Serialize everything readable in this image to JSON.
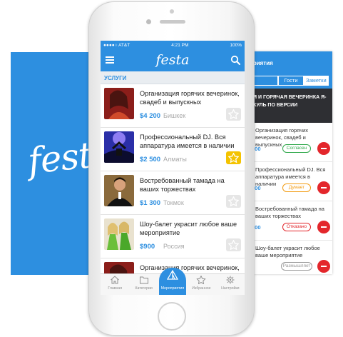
{
  "brand": {
    "logo": "festa",
    "accent": "#2d8fe0",
    "dark_banner": "#2e2f33",
    "star_active": "#f4c300"
  },
  "status_bar": {
    "carrier": "●●●●○ AT&T",
    "time": "4:21 PM",
    "battery": "100%"
  },
  "nav": {
    "menu_icon": "hamburger-icon",
    "search_icon": "search-icon"
  },
  "section_title": "УСЛУГИ",
  "items": [
    {
      "title": "Организация горячих вечеринок, свадеб и выпускных",
      "price": "$4 200",
      "city": "Бишкек",
      "favorite": false
    },
    {
      "title": "Профессиональный DJ. Вся аппаратура имеется в наличии",
      "price": "$2 500",
      "city": "Алматы",
      "favorite": true
    },
    {
      "title": "Востребованный тамада на ваших торжествах",
      "price": "$1 300",
      "city": "Токмок",
      "favorite": false
    },
    {
      "title": "Шоу-балет украсит любое ваше мероприятие",
      "price": "$900",
      "city": "Россия",
      "favorite": false
    },
    {
      "title": "Организация горячих вечеринок, свадеб и выпускных",
      "price": "",
      "city": "",
      "favorite": false
    }
  ],
  "tabbar": [
    {
      "label": "Главная",
      "icon": "home-icon",
      "active": false
    },
    {
      "label": "Категории",
      "icon": "folder-icon",
      "active": false
    },
    {
      "label": "Мероприятия",
      "icon": "tent-icon",
      "active": true
    },
    {
      "label": "Избранное",
      "icon": "star-icon",
      "active": false
    },
    {
      "label": "Настройки",
      "icon": "gear-icon",
      "active": false
    }
  ],
  "right_screen": {
    "header": "приятия",
    "segments": [
      "",
      "Гости",
      "Заметки"
    ],
    "banner": "Я И ГОРЯЧАЯ ВЕЧЕРИНКА Я-КУЛЬ ПО ВЕРСИИ",
    "rows": [
      {
        "title": "Организация горячих вечеринок, свадеб и выпускных",
        "price": "200",
        "status": "Согласен",
        "color": "#2ea84a"
      },
      {
        "title": "Профессиональный DJ. Вся аппаратура имеется в наличии",
        "price": "500",
        "status": "Думает",
        "color": "#f39c12"
      },
      {
        "title": "Востребованный тамада на ваших торжествах",
        "price": "300",
        "status": "Отказано",
        "color": "#e3262b"
      },
      {
        "title": "Шоу-балет украсит любое ваше мероприятие",
        "price": "",
        "status": "Размышляет",
        "color": "#9a9a9a"
      }
    ]
  }
}
